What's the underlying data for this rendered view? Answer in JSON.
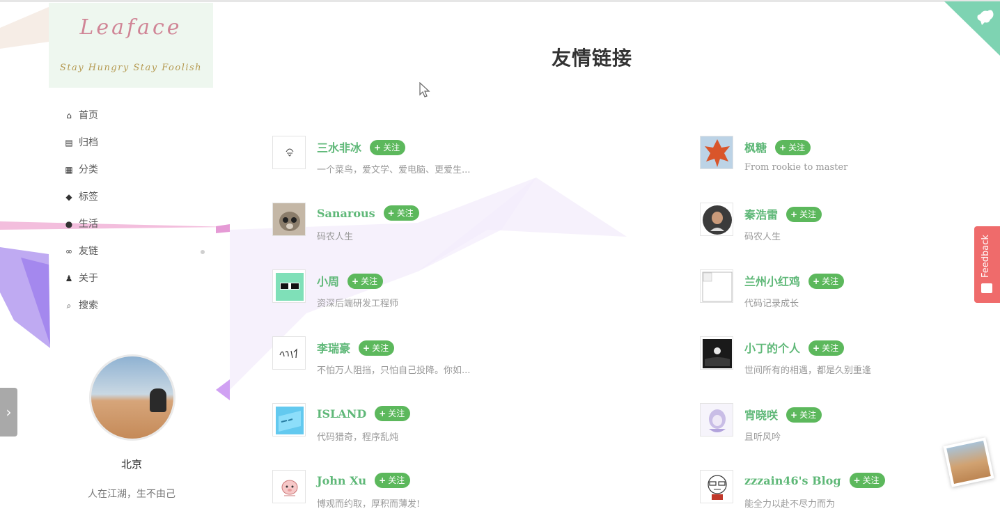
{
  "blog": {
    "logo_title": "Leaface",
    "logo_subtitle": "Stay Hungry Stay Foolish"
  },
  "menu": [
    {
      "label": "首页",
      "icon": "home-icon",
      "glyph": "⌂"
    },
    {
      "label": "归档",
      "icon": "archive-icon",
      "glyph": "▤"
    },
    {
      "label": "分类",
      "icon": "grid-icon",
      "glyph": "▦"
    },
    {
      "label": "标签",
      "icon": "tags-icon",
      "glyph": "◆"
    },
    {
      "label": "生活",
      "icon": "apple-icon",
      "glyph": "●"
    },
    {
      "label": "友链",
      "icon": "link-icon",
      "glyph": "∞"
    },
    {
      "label": "关于",
      "icon": "user-icon",
      "glyph": "♟"
    },
    {
      "label": "搜索",
      "icon": "search-icon",
      "glyph": "⌕"
    }
  ],
  "profile": {
    "name": "北京",
    "motto": "人在江湖，生不由己"
  },
  "page": {
    "title": "友情链接",
    "follow_label": "关注"
  },
  "links_left": [
    {
      "name": "三水非冰",
      "desc": "一个菜鸟，爱文学、爱电脑、更爱生..."
    },
    {
      "name": "Sanarous",
      "desc": "码农人生"
    },
    {
      "name": "小周",
      "desc": "资深后端研发工程师"
    },
    {
      "name": "李瑞豪",
      "desc": "不怕万人阻挡，只怕自己投降。你如..."
    },
    {
      "name": "ISLAND",
      "desc": "代码猎奇，程序乱炖"
    },
    {
      "name": "John Xu",
      "desc": "博观而约取，厚积而薄发!"
    }
  ],
  "links_right": [
    {
      "name": "枫糖",
      "desc": "From rookie to master"
    },
    {
      "name": "秦浩雷",
      "desc": "码农人生"
    },
    {
      "name": "兰州小红鸡",
      "desc": "代码记录成长"
    },
    {
      "name": "小丁的个人",
      "desc": "世间所有的相遇，都是久别重逢"
    },
    {
      "name": "宵晓咲",
      "desc": "且听风吟"
    },
    {
      "name": "zzzain46's Blog",
      "desc": "能全力以赴不尽力而为"
    }
  ],
  "feedback": {
    "label": "Feedback"
  },
  "colors": {
    "accent_green": "#5fb878",
    "follow_green": "#5cb85c",
    "feedback_red": "#ef6b6b",
    "ribbon_teal": "#7ed3b2"
  }
}
